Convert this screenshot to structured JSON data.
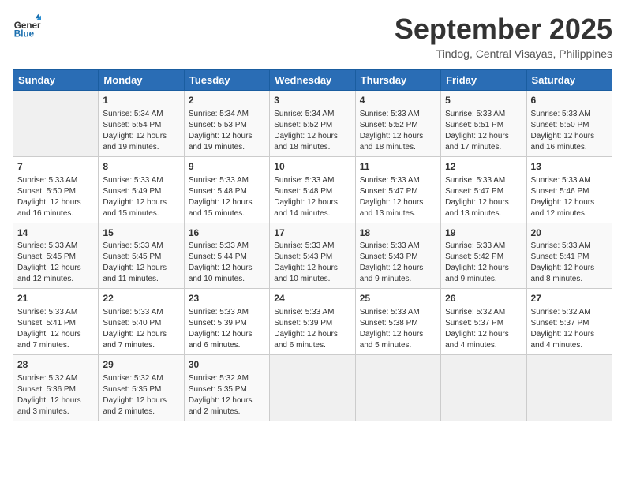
{
  "header": {
    "logo_general": "General",
    "logo_blue": "Blue",
    "month_title": "September 2025",
    "location": "Tindog, Central Visayas, Philippines"
  },
  "weekdays": [
    "Sunday",
    "Monday",
    "Tuesday",
    "Wednesday",
    "Thursday",
    "Friday",
    "Saturday"
  ],
  "weeks": [
    [
      {
        "day": "",
        "info": ""
      },
      {
        "day": "1",
        "info": "Sunrise: 5:34 AM\nSunset: 5:54 PM\nDaylight: 12 hours\nand 19 minutes."
      },
      {
        "day": "2",
        "info": "Sunrise: 5:34 AM\nSunset: 5:53 PM\nDaylight: 12 hours\nand 19 minutes."
      },
      {
        "day": "3",
        "info": "Sunrise: 5:34 AM\nSunset: 5:52 PM\nDaylight: 12 hours\nand 18 minutes."
      },
      {
        "day": "4",
        "info": "Sunrise: 5:33 AM\nSunset: 5:52 PM\nDaylight: 12 hours\nand 18 minutes."
      },
      {
        "day": "5",
        "info": "Sunrise: 5:33 AM\nSunset: 5:51 PM\nDaylight: 12 hours\nand 17 minutes."
      },
      {
        "day": "6",
        "info": "Sunrise: 5:33 AM\nSunset: 5:50 PM\nDaylight: 12 hours\nand 16 minutes."
      }
    ],
    [
      {
        "day": "7",
        "info": "Sunrise: 5:33 AM\nSunset: 5:50 PM\nDaylight: 12 hours\nand 16 minutes."
      },
      {
        "day": "8",
        "info": "Sunrise: 5:33 AM\nSunset: 5:49 PM\nDaylight: 12 hours\nand 15 minutes."
      },
      {
        "day": "9",
        "info": "Sunrise: 5:33 AM\nSunset: 5:48 PM\nDaylight: 12 hours\nand 15 minutes."
      },
      {
        "day": "10",
        "info": "Sunrise: 5:33 AM\nSunset: 5:48 PM\nDaylight: 12 hours\nand 14 minutes."
      },
      {
        "day": "11",
        "info": "Sunrise: 5:33 AM\nSunset: 5:47 PM\nDaylight: 12 hours\nand 13 minutes."
      },
      {
        "day": "12",
        "info": "Sunrise: 5:33 AM\nSunset: 5:47 PM\nDaylight: 12 hours\nand 13 minutes."
      },
      {
        "day": "13",
        "info": "Sunrise: 5:33 AM\nSunset: 5:46 PM\nDaylight: 12 hours\nand 12 minutes."
      }
    ],
    [
      {
        "day": "14",
        "info": "Sunrise: 5:33 AM\nSunset: 5:45 PM\nDaylight: 12 hours\nand 12 minutes."
      },
      {
        "day": "15",
        "info": "Sunrise: 5:33 AM\nSunset: 5:45 PM\nDaylight: 12 hours\nand 11 minutes."
      },
      {
        "day": "16",
        "info": "Sunrise: 5:33 AM\nSunset: 5:44 PM\nDaylight: 12 hours\nand 10 minutes."
      },
      {
        "day": "17",
        "info": "Sunrise: 5:33 AM\nSunset: 5:43 PM\nDaylight: 12 hours\nand 10 minutes."
      },
      {
        "day": "18",
        "info": "Sunrise: 5:33 AM\nSunset: 5:43 PM\nDaylight: 12 hours\nand 9 minutes."
      },
      {
        "day": "19",
        "info": "Sunrise: 5:33 AM\nSunset: 5:42 PM\nDaylight: 12 hours\nand 9 minutes."
      },
      {
        "day": "20",
        "info": "Sunrise: 5:33 AM\nSunset: 5:41 PM\nDaylight: 12 hours\nand 8 minutes."
      }
    ],
    [
      {
        "day": "21",
        "info": "Sunrise: 5:33 AM\nSunset: 5:41 PM\nDaylight: 12 hours\nand 7 minutes."
      },
      {
        "day": "22",
        "info": "Sunrise: 5:33 AM\nSunset: 5:40 PM\nDaylight: 12 hours\nand 7 minutes."
      },
      {
        "day": "23",
        "info": "Sunrise: 5:33 AM\nSunset: 5:39 PM\nDaylight: 12 hours\nand 6 minutes."
      },
      {
        "day": "24",
        "info": "Sunrise: 5:33 AM\nSunset: 5:39 PM\nDaylight: 12 hours\nand 6 minutes."
      },
      {
        "day": "25",
        "info": "Sunrise: 5:33 AM\nSunset: 5:38 PM\nDaylight: 12 hours\nand 5 minutes."
      },
      {
        "day": "26",
        "info": "Sunrise: 5:32 AM\nSunset: 5:37 PM\nDaylight: 12 hours\nand 4 minutes."
      },
      {
        "day": "27",
        "info": "Sunrise: 5:32 AM\nSunset: 5:37 PM\nDaylight: 12 hours\nand 4 minutes."
      }
    ],
    [
      {
        "day": "28",
        "info": "Sunrise: 5:32 AM\nSunset: 5:36 PM\nDaylight: 12 hours\nand 3 minutes."
      },
      {
        "day": "29",
        "info": "Sunrise: 5:32 AM\nSunset: 5:35 PM\nDaylight: 12 hours\nand 2 minutes."
      },
      {
        "day": "30",
        "info": "Sunrise: 5:32 AM\nSunset: 5:35 PM\nDaylight: 12 hours\nand 2 minutes."
      },
      {
        "day": "",
        "info": ""
      },
      {
        "day": "",
        "info": ""
      },
      {
        "day": "",
        "info": ""
      },
      {
        "day": "",
        "info": ""
      }
    ]
  ]
}
